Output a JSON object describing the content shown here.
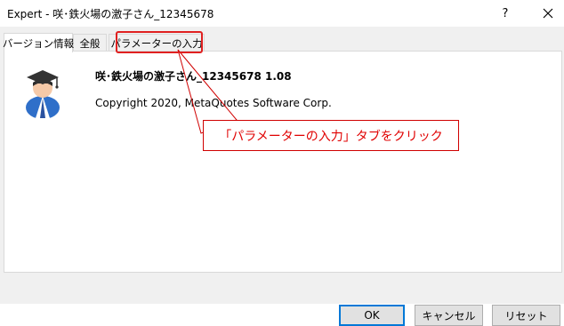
{
  "window": {
    "title": "Expert - 咲･鉄火場の激子さん_12345678",
    "help_label": "?",
    "close_icon": "close-icon"
  },
  "tabs": [
    {
      "label": "バージョン情報",
      "active": true
    },
    {
      "label": "全般",
      "active": false
    },
    {
      "label": "パラメーターの入力",
      "active": false
    }
  ],
  "about": {
    "ea_name": "咲･鉄火場の激子さん_12345678 1.08",
    "copyright": "Copyright 2020, MetaQuotes Software Corp.",
    "icon": "graduate-expert-icon"
  },
  "annotation": {
    "callout_text": "「パラメーターの入力」タブをクリック",
    "color": "#e00000"
  },
  "buttons": {
    "ok": "OK",
    "cancel": "キャンセル",
    "reset": "リセット"
  },
  "colors": {
    "accent": "#0078d7",
    "annotation_red": "#e00000",
    "dialog_bg": "#f0f0f0"
  }
}
